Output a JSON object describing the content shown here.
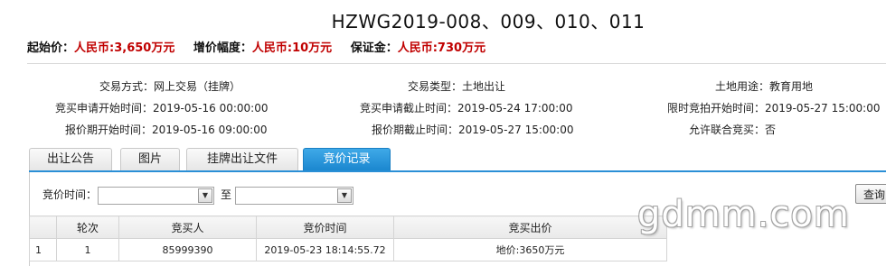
{
  "header": {
    "title": "HZWG2019-008、009、010、011"
  },
  "prices": {
    "start_label": "起始价：",
    "start_value": "人民币:3,650万元",
    "increment_label": "增价幅度：",
    "increment_value": "人民币:10万元",
    "deposit_label": "保证金：",
    "deposit_value": "人民币:730万元"
  },
  "info": {
    "trade_method_label": "交易方式：",
    "trade_method_value": "网上交易（挂牌）",
    "trade_type_label": "交易类型：",
    "trade_type_value": "土地出让",
    "land_use_label": "土地用途：",
    "land_use_value": "教育用地",
    "apply_start_label": "竞买申请开始时间：",
    "apply_start_value": "2019-05-16 00:00:00",
    "apply_end_label": "竞买申请截止时间：",
    "apply_end_value": "2019-05-24 17:00:00",
    "timed_bid_label": "限时竞拍开始时间：",
    "timed_bid_value": "2019-05-27 15:00:00",
    "quote_start_label": "报价期开始时间：",
    "quote_start_value": "2019-05-16 09:00:00",
    "quote_end_label": "报价期截止时间：",
    "quote_end_value": "2019-05-27 15:00:00",
    "joint_label": "允许联合竞买：",
    "joint_value": "否"
  },
  "tabs": [
    {
      "label": "出让公告"
    },
    {
      "label": "图片"
    },
    {
      "label": "挂牌出让文件"
    },
    {
      "label": "竞价记录"
    }
  ],
  "filter": {
    "label": "竞价时间：",
    "to_label": "至",
    "query_label": "查询"
  },
  "table": {
    "headers": [
      "",
      "轮次",
      "竞买人",
      "竞价时间",
      "竞买出价"
    ],
    "rows": [
      [
        "1",
        "1",
        "85999390",
        "2019-05-23 18:14:55.72",
        "地价:3650万元"
      ]
    ]
  },
  "watermark": "gdmm.com"
}
